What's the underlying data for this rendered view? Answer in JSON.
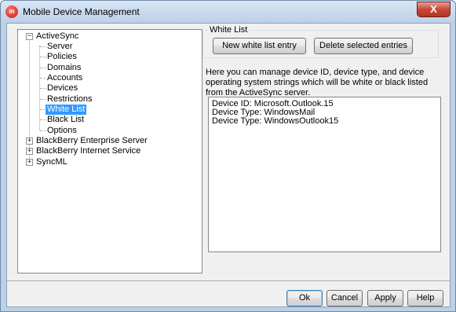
{
  "window": {
    "title": "Mobile Device Management",
    "close_label": "X"
  },
  "tree": {
    "activesync": {
      "label": "ActiveSync",
      "children": [
        "Server",
        "Policies",
        "Domains",
        "Accounts",
        "Devices",
        "Restrictions",
        "White List",
        "Black List",
        "Options"
      ]
    },
    "other_roots": [
      "BlackBerry Enterprise Server",
      "BlackBerry Internet Service",
      "SyncML"
    ]
  },
  "white_list": {
    "group_title": "White List",
    "new_entry_button": "New white list entry",
    "delete_entries_button": "Delete selected entries",
    "description": "Here you can manage device ID, device type, and device operating system strings which will be white or black listed from the ActiveSync server.",
    "entries": [
      "Device ID: Microsoft.Outlook.15",
      "Device Type: WindowsMail",
      "Device Type: WindowsOutlook15"
    ]
  },
  "buttons": {
    "ok": "Ok",
    "cancel": "Cancel",
    "apply": "Apply",
    "help": "Help"
  }
}
